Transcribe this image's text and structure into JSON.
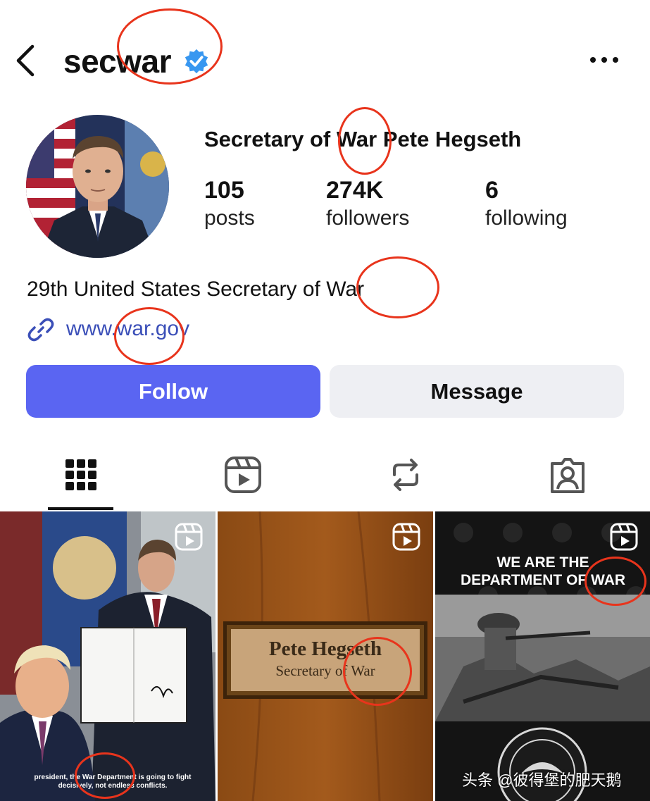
{
  "header": {
    "username": "secwar",
    "back_icon": "chevron-left-icon",
    "verified_icon": "verified-badge-icon",
    "more_icon": "more-horizontal-icon"
  },
  "profile": {
    "full_name": "Secretary of War Pete Hegseth",
    "stats": [
      {
        "value": "105",
        "label": "posts"
      },
      {
        "value": "274K",
        "label": "followers"
      },
      {
        "value": "6",
        "label": "following"
      }
    ],
    "bio": "29th United States Secretary of War",
    "link": "www.war.gov"
  },
  "actions": {
    "follow_label": "Follow",
    "message_label": "Message"
  },
  "tabs": [
    "grid-icon",
    "reels-icon",
    "reposts-icon",
    "tagged-icon"
  ],
  "grid": {
    "post1_caption": "president, the War Department is going to fight decisively, not endless conflicts.",
    "post2_plaque_name": "Pete Hegseth",
    "post2_plaque_title": "Secretary of War",
    "post3_slogan_line1": "WE ARE THE",
    "post3_slogan_line2": "DEPARTMENT OF WAR"
  },
  "watermark": "头条 @彼得堡的肥天鹅",
  "colors": {
    "accent": "#5a65f2",
    "link": "#3b4fb8",
    "verified": "#3897f0",
    "annotation": "#e8341c"
  }
}
